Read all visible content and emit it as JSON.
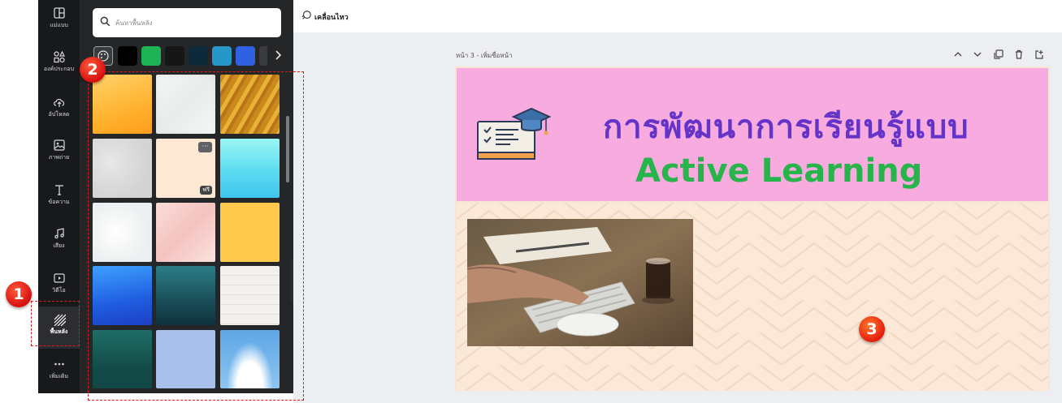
{
  "sidebar": {
    "items": [
      {
        "label": "แม่แบบ",
        "icon": "template-icon"
      },
      {
        "label": "องค์ประกอบ",
        "icon": "elements-icon"
      },
      {
        "label": "อัปโหลด",
        "icon": "upload-icon"
      },
      {
        "label": "ภาพถ่าย",
        "icon": "photo-icon"
      },
      {
        "label": "ข้อความ",
        "icon": "text-icon"
      },
      {
        "label": "เสียง",
        "icon": "music-icon"
      },
      {
        "label": "วิดีโอ",
        "icon": "video-icon"
      },
      {
        "label": "พื้นหลัง",
        "icon": "background-icon"
      },
      {
        "label": "เพิ่มเติม",
        "icon": "more-icon"
      }
    ]
  },
  "search": {
    "placeholder": "ค้นหาพื้นหลัง"
  },
  "swatches": [
    "#000000",
    "#1eb354",
    "#161616",
    "#0e2a3a",
    "#2597c8",
    "#2f62e3",
    "#3a3b3d"
  ],
  "background_tiles": [
    {
      "name": "orange-gradient-tile"
    },
    {
      "name": "white-marble-tile"
    },
    {
      "name": "golden-texture-tile"
    },
    {
      "name": "grey-texture-tile"
    },
    {
      "name": "peach-tile",
      "badge": "ฟรี",
      "menu": "···"
    },
    {
      "name": "cyan-gradient-tile"
    },
    {
      "name": "white-cloud-tile"
    },
    {
      "name": "pink-marble-tile"
    },
    {
      "name": "yellow-tile"
    },
    {
      "name": "blue-gradient-tile"
    },
    {
      "name": "teal-gradient-tile"
    },
    {
      "name": "white-wood-tile"
    },
    {
      "name": "dark-teal-tile"
    },
    {
      "name": "lavender-tile"
    },
    {
      "name": "sky-clouds-tile"
    }
  ],
  "topbar": {
    "label": "เคลื่อนไหว"
  },
  "page": {
    "label": "หน้า 3 - เพิ่มชื่อหน้า",
    "title_th": "การพัฒนาการเรียนรู้แบบ",
    "title_en": "Active Learning"
  },
  "callouts": {
    "one": "1",
    "two": "2",
    "three": "3"
  },
  "colors": {
    "rail": "#18191b",
    "panel": "#252627",
    "banner": "#f7abdf",
    "title_th": "#6433c7",
    "title_en": "#27b44a",
    "callout": "#e01b1b"
  }
}
